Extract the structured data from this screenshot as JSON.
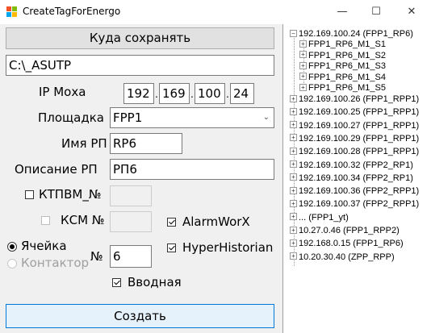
{
  "window": {
    "title": "CreateTagForEnergo",
    "minimize": "—",
    "maximize": "☐",
    "close": "✕"
  },
  "form": {
    "save_button": "Куда сохранять",
    "path_value": "C:\\_ASUTP",
    "ip_label": "IP Моха",
    "ip": [
      "192",
      "169",
      "100",
      "24"
    ],
    "site_label": "Площадка",
    "site_value": "FPP1",
    "rp_name_label": "Имя РП",
    "rp_name_value": "RP6",
    "rp_desc_label": "Описание РП",
    "rp_desc_value": "РП6",
    "ktpvm_label": "КТПВМ_№",
    "ksm_label": "КСМ №",
    "alarmworx_label": "AlarmWorX",
    "hyperhistorian_label": "HyperHistorian",
    "cell_label": "Ячейка",
    "contactor_label": "Контактор",
    "num_label": "№",
    "num_value": "6",
    "input_label": "Вводная",
    "create_button": "Создать"
  },
  "tree": {
    "root": "192.169.100.24 (FPP1_RP6)",
    "children": [
      "FPP1_RP6_M1_S1",
      "FPP1_RP6_M1_S2",
      "FPP1_RP6_M1_S3",
      "FPP1_RP6_M1_S4",
      "FPP1_RP6_M1_S5"
    ],
    "nodes": [
      "192.169.100.26 (FPP1_RPP1)",
      "192.169.100.25 (FPP1_RPP1)",
      "192.169.100.27 (FPP1_RPP1)",
      "192.169.100.29 (FPP1_RPP1)",
      "192.169.100.28 (FPP1_RPP1)",
      "192.169.100.32 (FPP2_RP1)",
      "192.169.100.34 (FPP2_RP1)",
      "192.169.100.36 (FPP2_RPP1)",
      "192.169.100.37 (FPP2_RPP1)",
      "... (FPP1_yt)",
      "10.27.0.46 (FPP1_RPP2)",
      "192.168.0.15 (FPP1_RP6)",
      "10.20.30.40 (ZPP_RPP)"
    ]
  },
  "colors": {
    "accent_border": "#0078d7",
    "button_bg": "#e1e1e1",
    "window_bg": "#f0f0f0"
  }
}
